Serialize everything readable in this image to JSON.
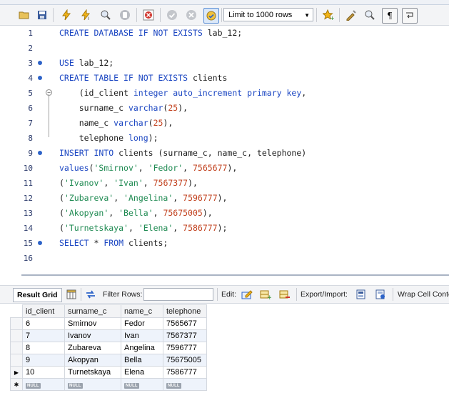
{
  "toolbar": {
    "icons": [
      "folder-open-icon",
      "save-icon",
      "execute-icon",
      "execute-statement-icon",
      "explain-icon",
      "stop-icon",
      "toggle-error-icon",
      "commit-icon",
      "rollback-icon",
      "autocommit-icon"
    ],
    "limit_label": "Limit to 1000 rows",
    "right_icons": [
      "add-snippet-icon",
      "beautify-icon",
      "find-icon",
      "invisibles-icon",
      "wrap-icon"
    ]
  },
  "editor": {
    "lines": [
      {
        "n": "1",
        "marker": false,
        "fold": "",
        "tokens": [
          [
            "kw",
            "CREATE DATABASE IF NOT EXISTS "
          ],
          [
            "t",
            "lab_12;"
          ]
        ]
      },
      {
        "n": "2",
        "marker": false,
        "fold": "",
        "tokens": []
      },
      {
        "n": "3",
        "marker": true,
        "fold": "",
        "tokens": [
          [
            "kw",
            "USE "
          ],
          [
            "t",
            "lab_12;"
          ]
        ]
      },
      {
        "n": "4",
        "marker": true,
        "fold": "",
        "tokens": [
          [
            "kw",
            "CREATE TABLE IF NOT EXISTS "
          ],
          [
            "t",
            "clients"
          ]
        ]
      },
      {
        "n": "5",
        "marker": false,
        "fold": "start",
        "tokens": [
          [
            "t",
            "    (id_client "
          ],
          [
            "kw",
            "integer auto_increment primary key"
          ],
          [
            "t",
            ","
          ]
        ]
      },
      {
        "n": "6",
        "marker": false,
        "fold": "mid",
        "tokens": [
          [
            "t",
            "    surname_c "
          ],
          [
            "kw",
            "varchar"
          ],
          [
            "t",
            "("
          ],
          [
            "num",
            "25"
          ],
          [
            "t",
            "),"
          ]
        ]
      },
      {
        "n": "7",
        "marker": false,
        "fold": "mid",
        "tokens": [
          [
            "t",
            "    name_c "
          ],
          [
            "kw",
            "varchar"
          ],
          [
            "t",
            "("
          ],
          [
            "num",
            "25"
          ],
          [
            "t",
            "),"
          ]
        ]
      },
      {
        "n": "8",
        "marker": false,
        "fold": "end",
        "tokens": [
          [
            "t",
            "    telephone "
          ],
          [
            "kw",
            "long"
          ],
          [
            "t",
            ");"
          ]
        ]
      },
      {
        "n": "9",
        "marker": true,
        "fold": "",
        "tokens": [
          [
            "kw",
            "INSERT INTO "
          ],
          [
            "t",
            "clients (surname_c, name_c, telephone)"
          ]
        ]
      },
      {
        "n": "10",
        "marker": false,
        "fold": "",
        "tokens": [
          [
            "kw",
            "values"
          ],
          [
            "t",
            "("
          ],
          [
            "str",
            "'Smirnov'"
          ],
          [
            "t",
            ", "
          ],
          [
            "str",
            "'Fedor'"
          ],
          [
            "t",
            ", "
          ],
          [
            "num",
            "7565677"
          ],
          [
            "t",
            "),"
          ]
        ]
      },
      {
        "n": "11",
        "marker": false,
        "fold": "",
        "tokens": [
          [
            "t",
            "("
          ],
          [
            "str",
            "'Ivanov'"
          ],
          [
            "t",
            ", "
          ],
          [
            "str",
            "'Ivan'"
          ],
          [
            "t",
            ", "
          ],
          [
            "num",
            "7567377"
          ],
          [
            "t",
            "),"
          ]
        ]
      },
      {
        "n": "12",
        "marker": false,
        "fold": "",
        "tokens": [
          [
            "t",
            "("
          ],
          [
            "str",
            "'Zubareva'"
          ],
          [
            "t",
            ", "
          ],
          [
            "str",
            "'Angelina'"
          ],
          [
            "t",
            ", "
          ],
          [
            "num",
            "7596777"
          ],
          [
            "t",
            "),"
          ]
        ]
      },
      {
        "n": "13",
        "marker": false,
        "fold": "",
        "tokens": [
          [
            "t",
            "("
          ],
          [
            "str",
            "'Akopyan'"
          ],
          [
            "t",
            ", "
          ],
          [
            "str",
            "'Bella'"
          ],
          [
            "t",
            ", "
          ],
          [
            "num",
            "75675005"
          ],
          [
            "t",
            "),"
          ]
        ]
      },
      {
        "n": "14",
        "marker": false,
        "fold": "",
        "tokens": [
          [
            "t",
            "("
          ],
          [
            "str",
            "'Turnetskaya'"
          ],
          [
            "t",
            ", "
          ],
          [
            "str",
            "'Elena'"
          ],
          [
            "t",
            ", "
          ],
          [
            "num",
            "7586777"
          ],
          [
            "t",
            ");"
          ]
        ]
      },
      {
        "n": "15",
        "marker": true,
        "fold": "",
        "tokens": [
          [
            "kw",
            "SELECT "
          ],
          [
            "t",
            "* "
          ],
          [
            "kw",
            "FROM "
          ],
          [
            "t",
            "clients;"
          ]
        ]
      },
      {
        "n": "16",
        "marker": false,
        "fold": "",
        "tokens": []
      }
    ]
  },
  "results": {
    "tab_label": "Result Grid",
    "filter_label": "Filter Rows:",
    "edit_label": "Edit:",
    "export_label": "Export/Import:",
    "wrap_label": "Wrap Cell Conte",
    "columns": [
      "id_client",
      "surname_c",
      "name_c",
      "telephone"
    ],
    "rows": [
      [
        "6",
        "Smirnov",
        "Fedor",
        "7565677"
      ],
      [
        "7",
        "Ivanov",
        "Ivan",
        "7567377"
      ],
      [
        "8",
        "Zubareva",
        "Angelina",
        "7596777"
      ],
      [
        "9",
        "Akopyan",
        "Bella",
        "75675005"
      ],
      [
        "10",
        "Turnetskaya",
        "Elena",
        "7586777"
      ]
    ],
    "null_label": "NULL"
  },
  "colors": {
    "keyword": "#1b46c2",
    "string": "#1f8a52",
    "number": "#c2421f",
    "marker": "#2d63c8"
  }
}
